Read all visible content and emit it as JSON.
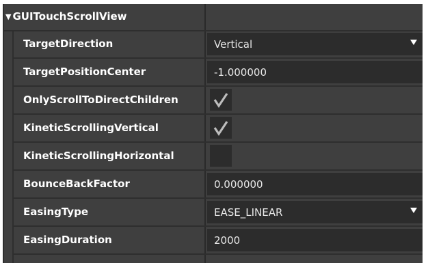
{
  "component": {
    "title": "GUITouchScrollView",
    "expanded": true,
    "expander_icon": "triangle-down-icon"
  },
  "properties": [
    {
      "name": "TargetDirection",
      "type": "dropdown",
      "value": "Vertical"
    },
    {
      "name": "TargetPositionCenter",
      "type": "text",
      "value": "-1.000000"
    },
    {
      "name": "OnlyScrollToDirectChildren",
      "type": "checkbox",
      "checked": true
    },
    {
      "name": "KineticScrollingVertical",
      "type": "checkbox",
      "checked": true
    },
    {
      "name": "KineticScrollingHorizontal",
      "type": "checkbox",
      "checked": false
    },
    {
      "name": "BounceBackFactor",
      "type": "text",
      "value": "0.000000"
    },
    {
      "name": "EasingType",
      "type": "dropdown",
      "value": "EASE_LINEAR"
    },
    {
      "name": "EasingDuration",
      "type": "text",
      "value": "2000"
    }
  ],
  "colors": {
    "panel_bg": "#3f3f3f",
    "field_bg": "#2c2c2c",
    "grid_line": "#2e2e2e",
    "text": "#ffffff"
  }
}
